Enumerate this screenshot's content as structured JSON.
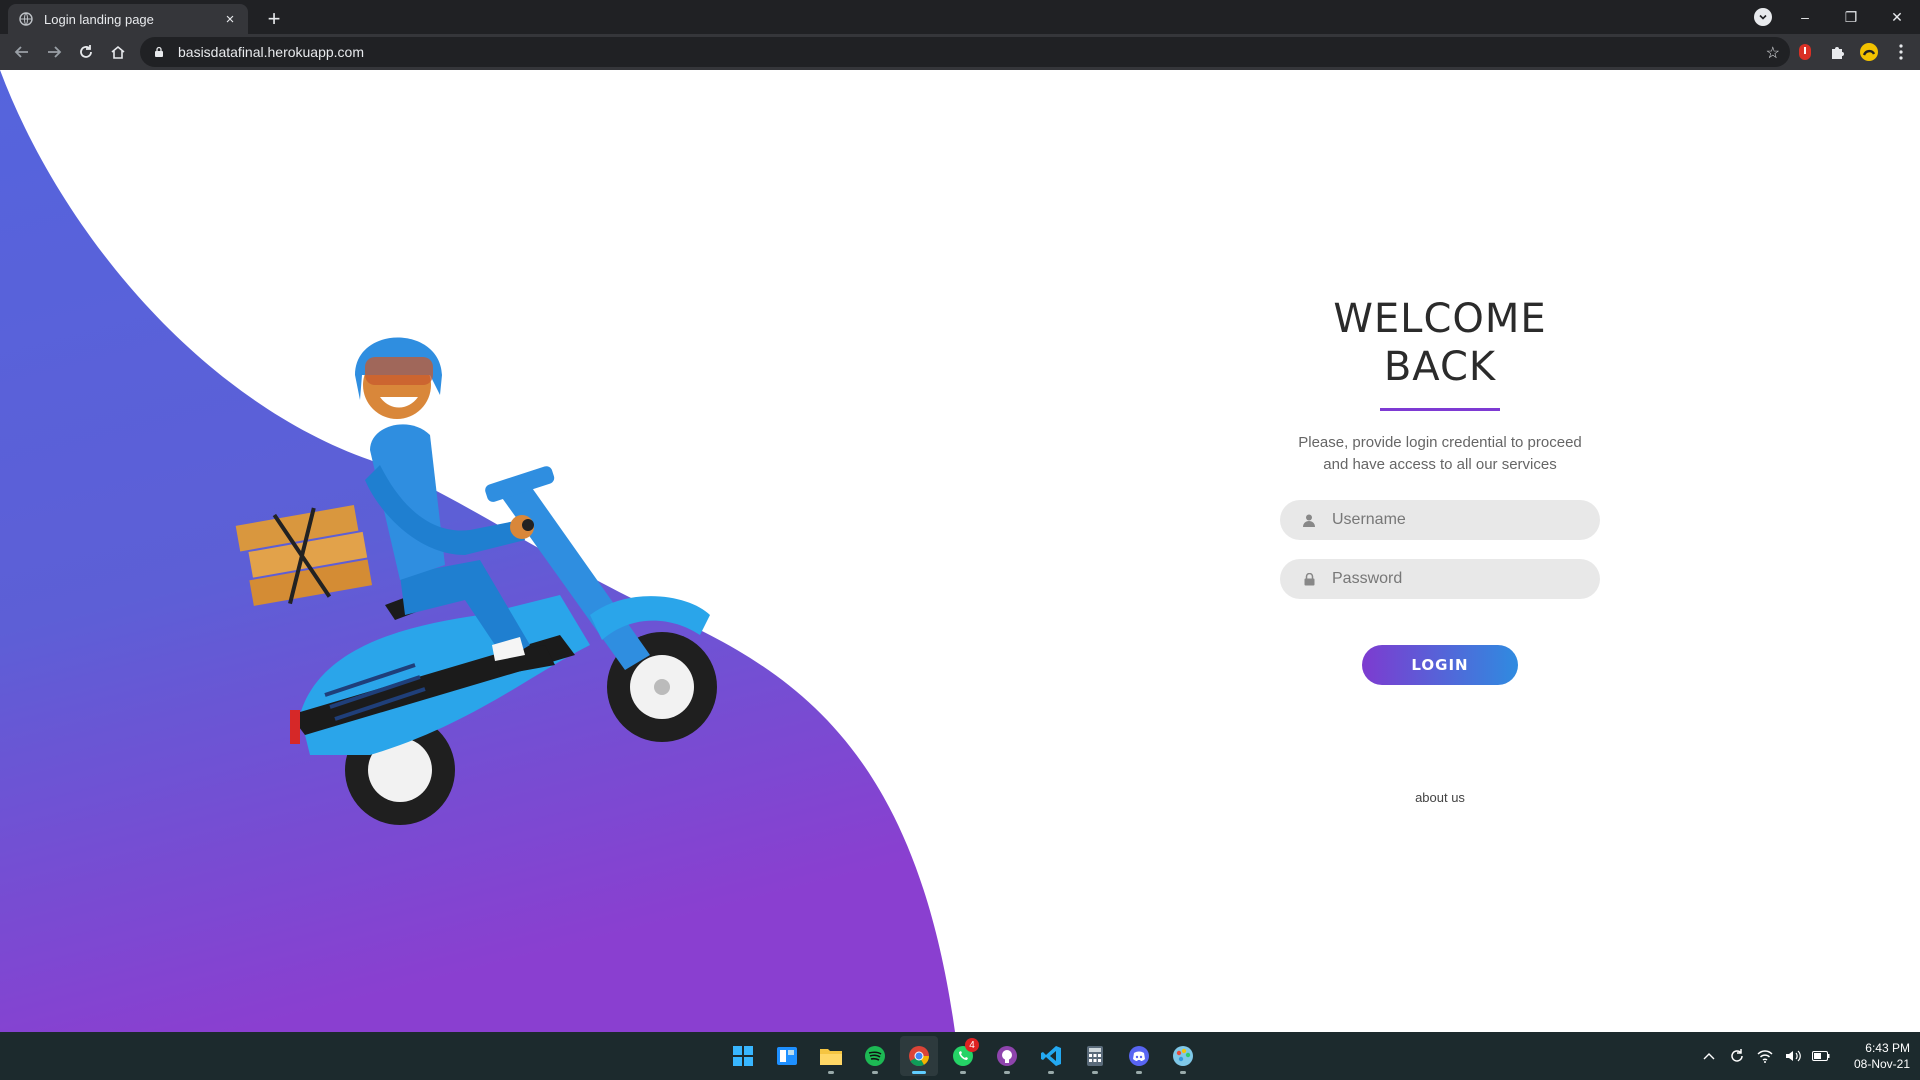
{
  "browser": {
    "tab_title": "Login landing page",
    "tab_close": "×",
    "new_tab": "+",
    "url": "basisdatafinal.herokuapp.com",
    "window_controls": {
      "minimize": "–",
      "restore": "❐",
      "close": "✕"
    }
  },
  "login": {
    "heading_line1": "WELCOME",
    "heading_line2": "BACK",
    "subtitle_line1": "Please, provide login credential to proceed",
    "subtitle_line2": "and have access to all our services",
    "username_placeholder": "Username",
    "password_placeholder": "Password",
    "login_button": "LOGIN",
    "about_link": "about us"
  },
  "colors": {
    "wave_top": "#5b5fd8",
    "wave_bottom": "#8a3fd0",
    "accent": "#7e3ad3",
    "button_start": "#7d3bd0",
    "button_end": "#2f8be0"
  },
  "taskbar": {
    "apps": [
      {
        "name": "windows-start-icon"
      },
      {
        "name": "widgets-icon"
      },
      {
        "name": "file-explorer-icon"
      },
      {
        "name": "spotify-icon"
      },
      {
        "name": "chrome-icon",
        "active": true
      },
      {
        "name": "whatsapp-icon",
        "badge": "4"
      },
      {
        "name": "github-desktop-icon"
      },
      {
        "name": "vscode-icon"
      },
      {
        "name": "calculator-icon"
      },
      {
        "name": "discord-icon"
      },
      {
        "name": "paint-icon"
      }
    ],
    "whatsapp_badge": "4",
    "time": "6:43 PM",
    "date": "08-Nov-21"
  }
}
